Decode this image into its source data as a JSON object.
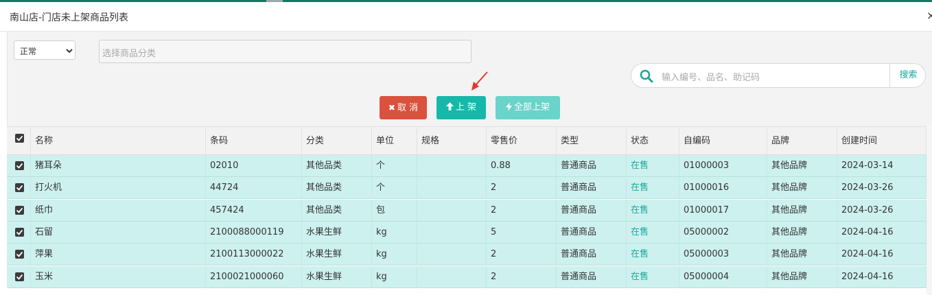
{
  "window": {
    "title": "南山店-门店未上架商品列表",
    "close_glyph": "×"
  },
  "filters": {
    "status_value": "正常",
    "category_placeholder": "选择商品分类"
  },
  "search": {
    "placeholder": "输入编号、品名、助记码",
    "button_label": "搜索"
  },
  "actions": {
    "cancel_label": "取 消",
    "on_shelf_label": "上 架",
    "all_on_shelf_label": "全部上架"
  },
  "colors": {
    "accent": "#17b8aa",
    "danger": "#d9523d",
    "row_selected": "#cdf1ef",
    "status_text": "#1aa79a"
  },
  "table": {
    "columns": [
      "名称",
      "条码",
      "分类",
      "单位",
      "规格",
      "零售价",
      "类型",
      "状态",
      "自编码",
      "品牌",
      "创建时间"
    ],
    "rows": [
      {
        "name": "猪耳朵",
        "barcode": "02010",
        "category": "其他品类",
        "unit": "个",
        "spec": "",
        "price": "0.88",
        "type": "普通商品",
        "status": "在售",
        "code": "01000003",
        "brand": "其他品牌",
        "created": "2024-03-14"
      },
      {
        "name": "打火机",
        "barcode": "44724",
        "category": "其他品类",
        "unit": "个",
        "spec": "",
        "price": "2",
        "type": "普通商品",
        "status": "在售",
        "code": "01000016",
        "brand": "其他品牌",
        "created": "2024-03-26"
      },
      {
        "name": "纸巾",
        "barcode": "457424",
        "category": "其他品类",
        "unit": "包",
        "spec": "",
        "price": "2",
        "type": "普通商品",
        "status": "在售",
        "code": "01000017",
        "brand": "其他品牌",
        "created": "2024-03-26"
      },
      {
        "name": "石留",
        "barcode": "2100088000119",
        "category": "水果生鲜",
        "unit": "kg",
        "spec": "",
        "price": "5",
        "type": "普通商品",
        "status": "在售",
        "code": "05000002",
        "brand": "其他品牌",
        "created": "2024-04-16"
      },
      {
        "name": "萍果",
        "barcode": "2100113000022",
        "category": "水果生鲜",
        "unit": "kg",
        "spec": "",
        "price": "2",
        "type": "普通商品",
        "status": "在售",
        "code": "05000003",
        "brand": "其他品牌",
        "created": "2024-04-16"
      },
      {
        "name": "玉米",
        "barcode": "2100021000060",
        "category": "水果生鲜",
        "unit": "kg",
        "spec": "",
        "price": "2",
        "type": "普通商品",
        "status": "在售",
        "code": "05000004",
        "brand": "其他品牌",
        "created": "2024-04-16"
      }
    ]
  }
}
